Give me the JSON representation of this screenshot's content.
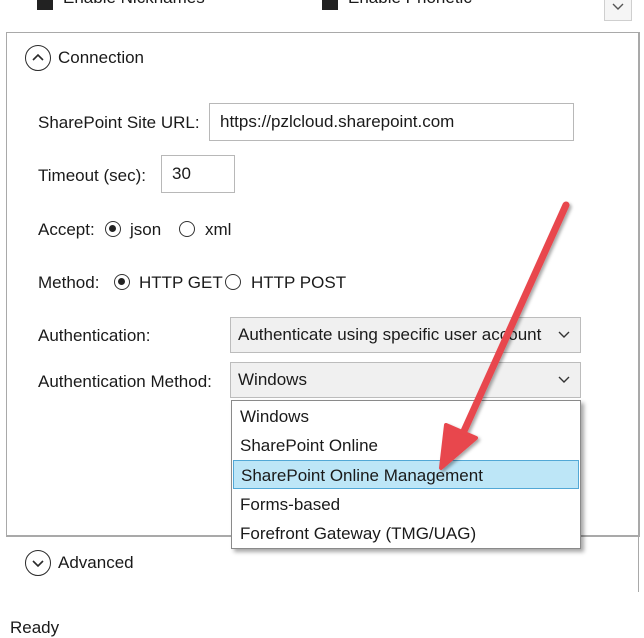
{
  "top_row": {
    "left_checkbox_label": "Enable Nicknames",
    "right_checkbox_label": "Enable Phonetic"
  },
  "connection": {
    "section_title": "Connection",
    "site_url_label": "SharePoint Site URL:",
    "site_url_value": "https://pzlcloud.sharepoint.com",
    "timeout_label": "Timeout (sec):",
    "timeout_value": "30",
    "accept_label": "Accept:",
    "accept_options": [
      "json",
      "xml"
    ],
    "accept_selected": "json",
    "method_label": "Method:",
    "method_options": [
      "HTTP GET",
      "HTTP POST"
    ],
    "method_selected": "HTTP GET",
    "authentication_label": "Authentication:",
    "authentication_value": "Authenticate using specific user account",
    "auth_method_label": "Authentication Method:",
    "auth_method_value": "Windows",
    "auth_method_options": [
      "Windows",
      "SharePoint Online",
      "SharePoint Online Management",
      "Forms-based",
      "Forefront Gateway (TMG/UAG)"
    ],
    "auth_method_highlighted": "SharePoint Online Management"
  },
  "advanced": {
    "section_title": "Advanced"
  },
  "status_bar": {
    "text": "Ready"
  },
  "colors": {
    "highlight_bg": "#bde6f7",
    "highlight_border": "#52a8d6",
    "arrow": "#e8464e",
    "panel_border": "#a9a9a9"
  },
  "icons": {
    "collapse": "chevron-up-circle-icon",
    "expand": "chevron-down-circle-icon",
    "dropdown": "chevron-down-icon",
    "annotation": "red-arrow"
  }
}
